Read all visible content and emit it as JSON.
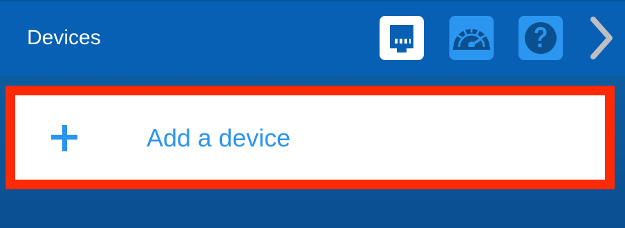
{
  "header": {
    "title": "Devices",
    "icons": [
      "network-port-icon",
      "speedometer-icon",
      "help-icon",
      "chevron-right-icon"
    ]
  },
  "device_list": {
    "add_device_label": "Add a device",
    "add_icon": "plus-icon"
  },
  "colors": {
    "header_background": "#0760B3",
    "accent": "#2A94F0",
    "highlight_border": "#FE2A05",
    "page_background": "#08549A"
  }
}
